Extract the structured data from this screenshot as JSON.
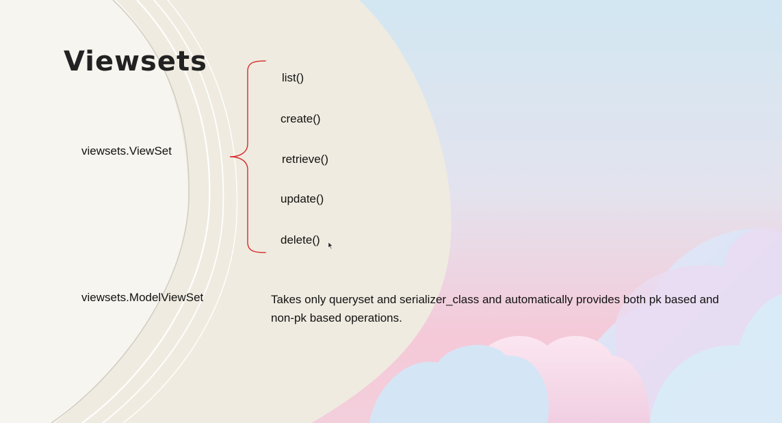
{
  "slide": {
    "title": "Viewsets",
    "viewset_label": "viewsets.ViewSet",
    "methods": [
      "list()",
      "create()",
      "retrieve()",
      "update()",
      "delete()"
    ],
    "modelviewset_label": "viewsets.ModelViewSet",
    "modelviewset_description": "Takes only queryset and serializer_class and automatically provides both pk based and non-pk based operations.",
    "colors": {
      "brace": "#d62a2a",
      "title": "#222222",
      "sky_top": "#d2e7f2",
      "sky_bottom": "#f3c8d9",
      "beige": "#efebe0",
      "paper": "#f7f5ef"
    }
  }
}
